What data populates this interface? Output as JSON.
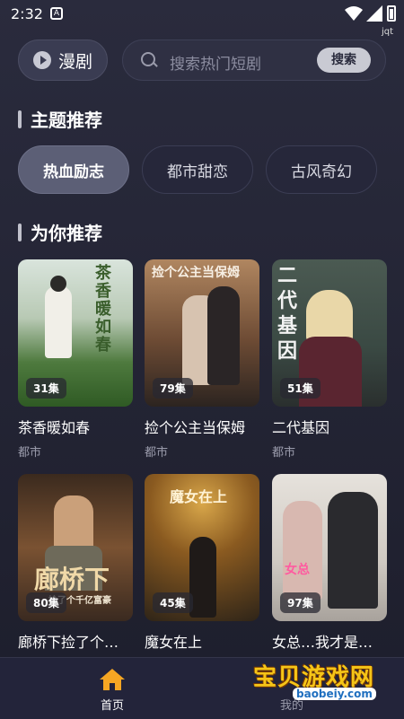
{
  "status_bar": {
    "time": "2:32",
    "user_tag": "jqt",
    "app_icon": "A"
  },
  "header": {
    "brand_label": "漫剧",
    "search_placeholder": "搜索热门短剧",
    "search_button": "搜索"
  },
  "themes": {
    "title": "主题推荐",
    "chips": [
      {
        "label": "热血励志",
        "active": true
      },
      {
        "label": "都市甜恋",
        "active": false
      },
      {
        "label": "古风奇幻",
        "active": false
      }
    ]
  },
  "recommend": {
    "title": "为你推荐",
    "cards": [
      {
        "title": "茶香暖如春",
        "genre": "都市",
        "episodes": "31集",
        "poster_text": "茶香暖如春"
      },
      {
        "title": "捡个公主当保姆",
        "genre": "都市",
        "episodes": "79集",
        "poster_text": "捡个公主当保姆"
      },
      {
        "title": "二代基因",
        "genre": "都市",
        "episodes": "51集",
        "poster_text": "二代 基因"
      },
      {
        "title": "廊桥下捡了个…",
        "genre": "",
        "episodes": "80集",
        "poster_text": "廊桥下",
        "poster_sub": "捡了个千亿富豪"
      },
      {
        "title": "魔女在上",
        "genre": "",
        "episodes": "45集",
        "poster_text": "魔女在上"
      },
      {
        "title": "女总…我才是…",
        "genre": "",
        "episodes": "97集",
        "poster_text": "女总"
      }
    ]
  },
  "bottom_nav": {
    "home_label": "首页",
    "mine_label": "我的"
  },
  "watermark": {
    "text": "宝贝游戏网",
    "url": "baobeiy.com"
  },
  "colors": {
    "accent": "#f5a623",
    "background": "#1d1e2c"
  }
}
